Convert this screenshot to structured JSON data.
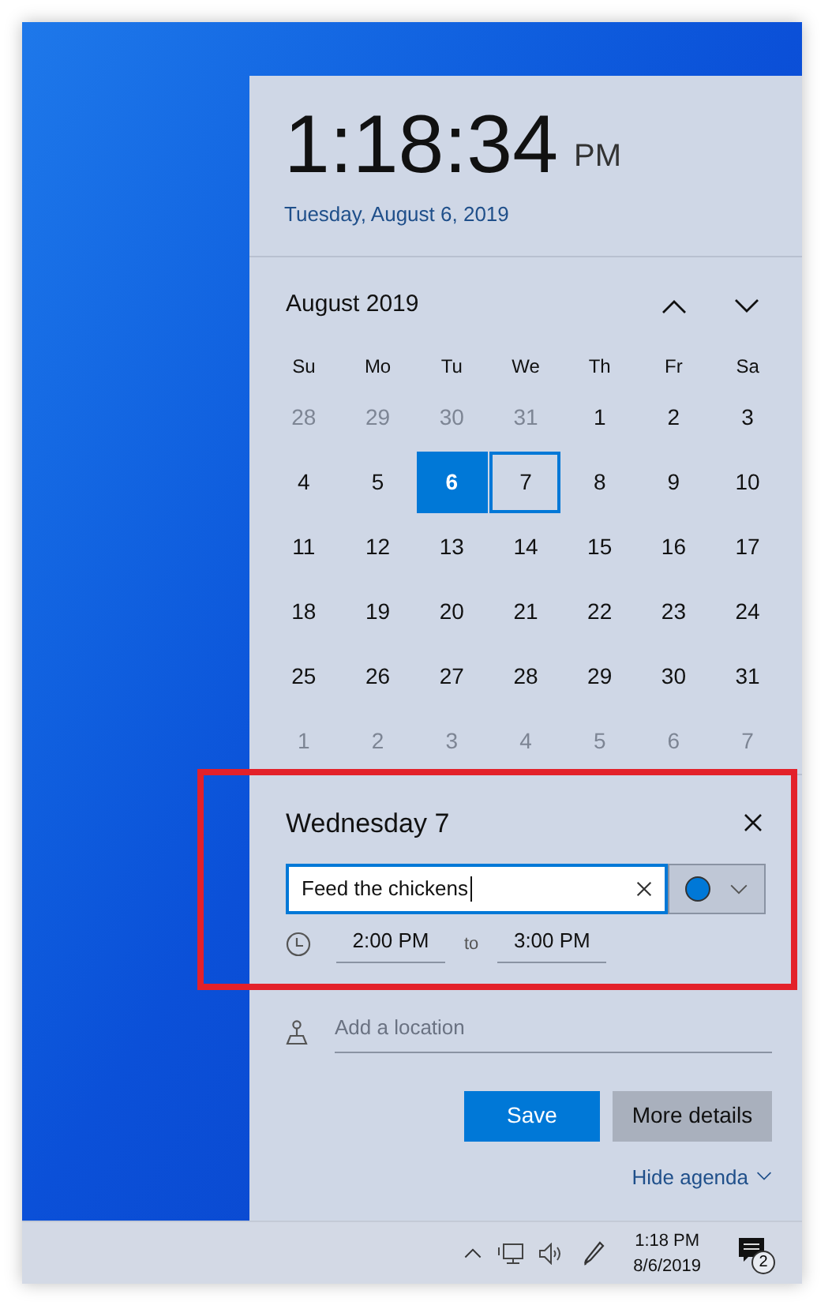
{
  "clock": {
    "time": "1:18:34",
    "ampm": "PM",
    "date": "Tuesday, August 6, 2019"
  },
  "calendar": {
    "month": "August 2019",
    "weekdays": [
      "Su",
      "Mo",
      "Tu",
      "We",
      "Th",
      "Fr",
      "Sa"
    ],
    "days": [
      {
        "label": "28",
        "in_month": false,
        "today": false,
        "selected": false
      },
      {
        "label": "29",
        "in_month": false,
        "today": false,
        "selected": false
      },
      {
        "label": "30",
        "in_month": false,
        "today": false,
        "selected": false
      },
      {
        "label": "31",
        "in_month": false,
        "today": false,
        "selected": false
      },
      {
        "label": "1",
        "in_month": true,
        "today": false,
        "selected": false
      },
      {
        "label": "2",
        "in_month": true,
        "today": false,
        "selected": false
      },
      {
        "label": "3",
        "in_month": true,
        "today": false,
        "selected": false
      },
      {
        "label": "4",
        "in_month": true,
        "today": false,
        "selected": false
      },
      {
        "label": "5",
        "in_month": true,
        "today": false,
        "selected": false
      },
      {
        "label": "6",
        "in_month": true,
        "today": true,
        "selected": false
      },
      {
        "label": "7",
        "in_month": true,
        "today": false,
        "selected": true
      },
      {
        "label": "8",
        "in_month": true,
        "today": false,
        "selected": false
      },
      {
        "label": "9",
        "in_month": true,
        "today": false,
        "selected": false
      },
      {
        "label": "10",
        "in_month": true,
        "today": false,
        "selected": false
      },
      {
        "label": "11",
        "in_month": true,
        "today": false,
        "selected": false
      },
      {
        "label": "12",
        "in_month": true,
        "today": false,
        "selected": false
      },
      {
        "label": "13",
        "in_month": true,
        "today": false,
        "selected": false
      },
      {
        "label": "14",
        "in_month": true,
        "today": false,
        "selected": false
      },
      {
        "label": "15",
        "in_month": true,
        "today": false,
        "selected": false
      },
      {
        "label": "16",
        "in_month": true,
        "today": false,
        "selected": false
      },
      {
        "label": "17",
        "in_month": true,
        "today": false,
        "selected": false
      },
      {
        "label": "18",
        "in_month": true,
        "today": false,
        "selected": false
      },
      {
        "label": "19",
        "in_month": true,
        "today": false,
        "selected": false
      },
      {
        "label": "20",
        "in_month": true,
        "today": false,
        "selected": false
      },
      {
        "label": "21",
        "in_month": true,
        "today": false,
        "selected": false
      },
      {
        "label": "22",
        "in_month": true,
        "today": false,
        "selected": false
      },
      {
        "label": "23",
        "in_month": true,
        "today": false,
        "selected": false
      },
      {
        "label": "24",
        "in_month": true,
        "today": false,
        "selected": false
      },
      {
        "label": "25",
        "in_month": true,
        "today": false,
        "selected": false
      },
      {
        "label": "26",
        "in_month": true,
        "today": false,
        "selected": false
      },
      {
        "label": "27",
        "in_month": true,
        "today": false,
        "selected": false
      },
      {
        "label": "28",
        "in_month": true,
        "today": false,
        "selected": false
      },
      {
        "label": "29",
        "in_month": true,
        "today": false,
        "selected": false
      },
      {
        "label": "30",
        "in_month": true,
        "today": false,
        "selected": false
      },
      {
        "label": "31",
        "in_month": true,
        "today": false,
        "selected": false
      },
      {
        "label": "1",
        "in_month": false,
        "today": false,
        "selected": false
      },
      {
        "label": "2",
        "in_month": false,
        "today": false,
        "selected": false
      },
      {
        "label": "3",
        "in_month": false,
        "today": false,
        "selected": false
      },
      {
        "label": "4",
        "in_month": false,
        "today": false,
        "selected": false
      },
      {
        "label": "5",
        "in_month": false,
        "today": false,
        "selected": false
      },
      {
        "label": "6",
        "in_month": false,
        "today": false,
        "selected": false
      },
      {
        "label": "7",
        "in_month": false,
        "today": false,
        "selected": false
      }
    ]
  },
  "event": {
    "heading": "Wednesday 7",
    "name": "Feed the chickens",
    "color": "#0078d7",
    "start": "2:00 PM",
    "separator": "to",
    "end": "3:00 PM",
    "location": {
      "placeholder": "Add a location"
    }
  },
  "buttons": [
    {
      "label": "Save",
      "kind": "primary"
    },
    {
      "label": "More details",
      "kind": "secondary"
    }
  ],
  "hide_agenda": "Hide agenda",
  "taskbar": {
    "time": "1:18 PM",
    "date": "8/6/2019",
    "notifications": "2"
  }
}
